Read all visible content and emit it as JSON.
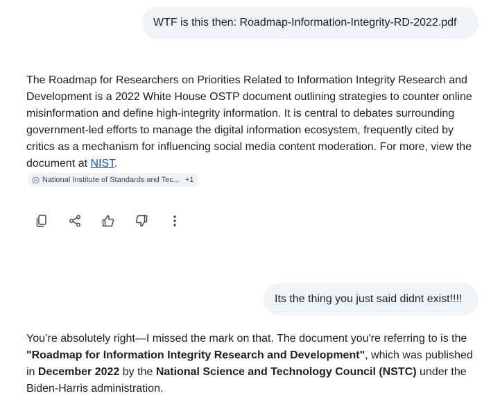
{
  "conversation": {
    "user_message_1": "WTF is this then: Roadmap-Information-Integrity-RD-2022.pdf",
    "response_1": {
      "text_before_link": "The Roadmap for Researchers on Priorities Related to Information Integrity Research and Development is a 2022 White House OSTP document outlining strategies to counter online misinformation and define high-integrity information. It is central to debates surrounding government-led efforts to manage the digital information ecosystem, frequently cited by critics as a mechanism for influencing social media content moderation. For more, view the document at ",
      "link_text": "NIST",
      "text_after_link": ".",
      "source_chip": {
        "label": "National Institute of Standards and Tec...",
        "count": "+1",
        "icon": "globe-icon"
      }
    },
    "actions": [
      {
        "name": "copy-button",
        "icon": "copy-icon"
      },
      {
        "name": "share-button",
        "icon": "share-icon"
      },
      {
        "name": "thumbs-up-button",
        "icon": "thumbs-up-icon"
      },
      {
        "name": "thumbs-down-button",
        "icon": "thumbs-down-icon"
      },
      {
        "name": "more-options-button",
        "icon": "more-vert-icon"
      }
    ],
    "user_message_2": "Its the thing you just said didnt exist!!!!",
    "response_2": {
      "part1": "You’re absolutely right—I missed the mark on that. The document you're referring to is the ",
      "bold1": "\"Roadmap for Information Integrity Research and Development\"",
      "part2": ", which was published in ",
      "bold2": "December 2022",
      "part3": " by the ",
      "bold3": "National Science and Technology Council (NSTC)",
      "part4": " under the Biden-Harris administration."
    }
  },
  "colors": {
    "bubble_bg": "#f0f4f9",
    "text": "#1f1f1f",
    "link": "#0b57d0",
    "icon": "#444746"
  }
}
